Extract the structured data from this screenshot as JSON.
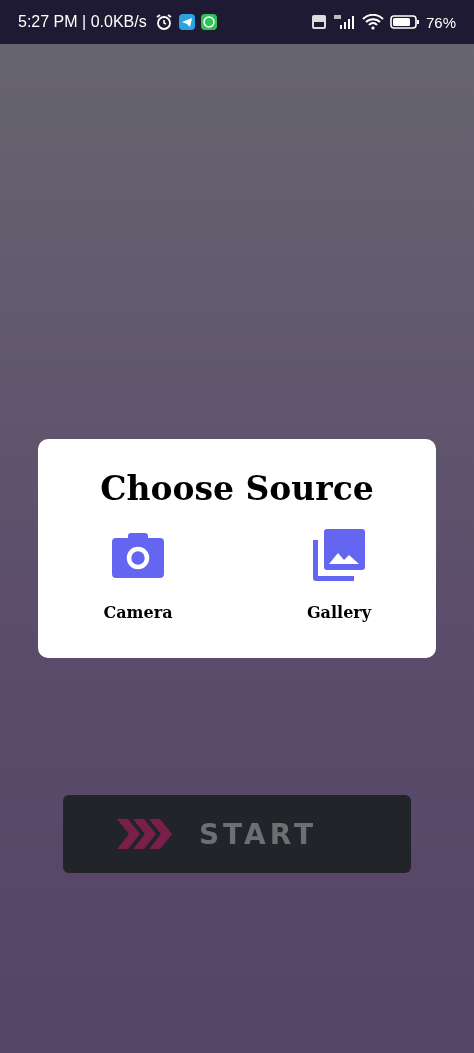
{
  "status_bar": {
    "time": "5:27 PM | 0.0KB/s",
    "battery_text": "76%"
  },
  "dialog": {
    "title": "Choose Source",
    "options": [
      {
        "kind": "camera",
        "label": "Camera"
      },
      {
        "kind": "gallery",
        "label": "Gallery"
      }
    ]
  },
  "start_button": {
    "label": "START"
  }
}
